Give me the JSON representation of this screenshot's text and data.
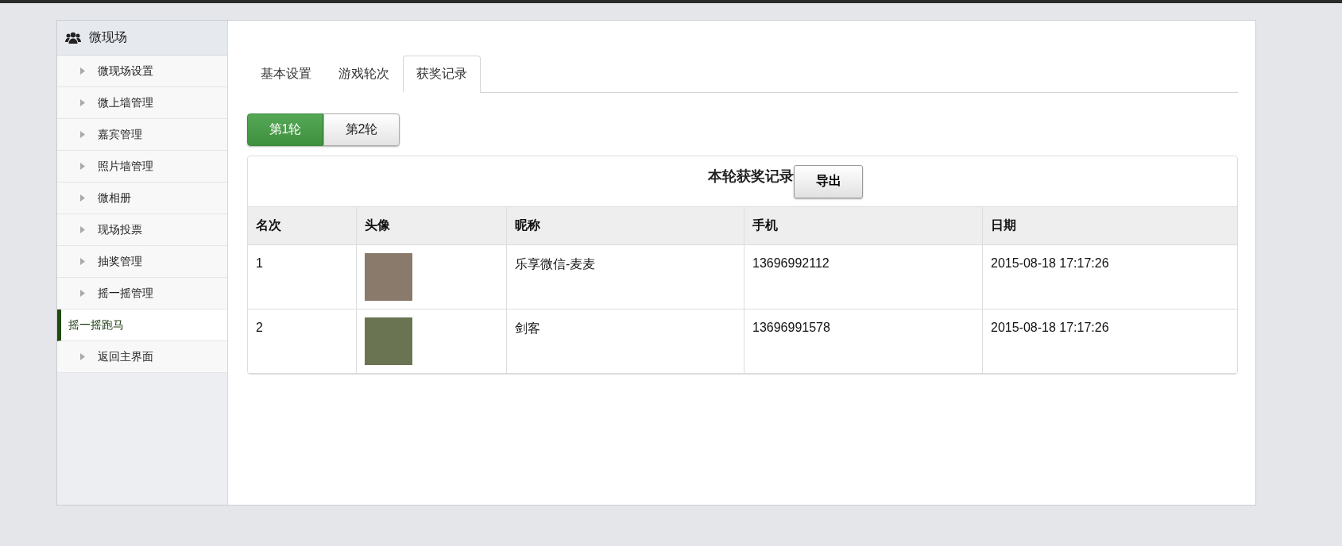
{
  "sidebar": {
    "title": "微现场",
    "items": [
      {
        "label": "微现场设置",
        "selected": false
      },
      {
        "label": "微上墙管理",
        "selected": false
      },
      {
        "label": "嘉宾管理",
        "selected": false
      },
      {
        "label": "照片墙管理",
        "selected": false
      },
      {
        "label": "微相册",
        "selected": false
      },
      {
        "label": "现场投票",
        "selected": false
      },
      {
        "label": "抽奖管理",
        "selected": false
      },
      {
        "label": "摇一摇管理",
        "selected": false
      },
      {
        "label": "摇一摇跑马",
        "selected": true
      },
      {
        "label": "返回主界面",
        "selected": false
      }
    ]
  },
  "tabs": [
    {
      "label": "基本设置",
      "selected": false
    },
    {
      "label": "游戏轮次",
      "selected": false
    },
    {
      "label": "获奖记录",
      "selected": true
    }
  ],
  "rounds": [
    {
      "label": "第1轮",
      "selected": true
    },
    {
      "label": "第2轮",
      "selected": false
    }
  ],
  "records": {
    "title": "本轮获奖记录",
    "export_button": "导出",
    "columns": [
      "名次",
      "头像",
      "昵称",
      "手机",
      "日期"
    ],
    "rows": [
      {
        "rank": "1",
        "nickname": "乐享微信-麦麦",
        "phone": "13696992112",
        "date": "2015-08-18 17:17:26"
      },
      {
        "rank": "2",
        "nickname": "剑客",
        "phone": "13696991578",
        "date": "2015-08-18 17:17:26"
      }
    ]
  }
}
